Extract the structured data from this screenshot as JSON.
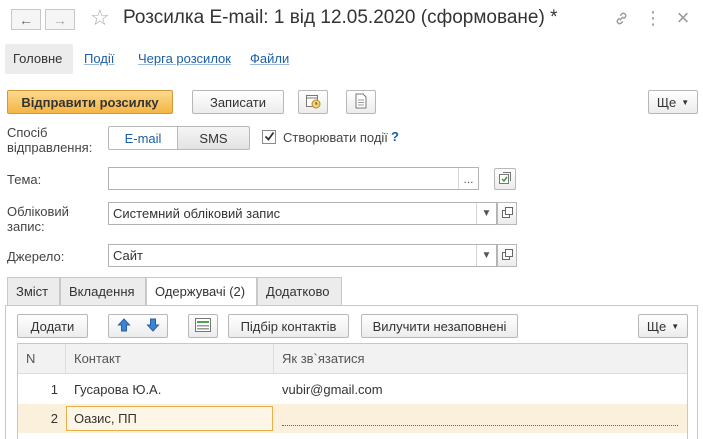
{
  "window": {
    "title": "Розсилка E-mail: 1 від 12.05.2020 (сформоване) *",
    "back_icon": "←",
    "forward_icon": "→",
    "star_icon": "☆",
    "link_icon": "🔗",
    "more_icon": "⋮",
    "close_icon": "×"
  },
  "top_tabs": [
    "Головне",
    "Події",
    "Черга розсилок",
    "Файли"
  ],
  "toolbar": {
    "send_label": "Відправити розсилку",
    "save_label": "Записати",
    "more_label": "Ще"
  },
  "form": {
    "send_method_label": "Спосіб відправлення:",
    "method_email": "E-mail",
    "method_sms": "SMS",
    "create_events_label": "Створювати події",
    "create_events_checked": true,
    "help_label": "?",
    "subject_label": "Тема:",
    "subject_value": "",
    "account_label": "Обліковий запис:",
    "account_value": "Системний обліковий запис",
    "source_label": "Джерело:",
    "source_value": "Сайт",
    "ellipsis": "..."
  },
  "inner_tabs": [
    "Зміст",
    "Вкладення",
    "Одержувачі (2)",
    "Додатково"
  ],
  "inner_toolbar": {
    "add_label": "Додати",
    "pick_contacts_label": "Підбір контактів",
    "remove_empty_label": "Вилучити незаповнені",
    "more_label": "Ще"
  },
  "table": {
    "columns": [
      "N",
      "Контакт",
      "Як зв`язатися"
    ],
    "rows": [
      {
        "n": "1",
        "contact": "Гусарова Ю.А.",
        "how": "vubir@gmail.com"
      },
      {
        "n": "2",
        "contact": "Оазис, ПП",
        "how": ""
      }
    ]
  },
  "colors": {
    "primary_button": "#f4b545",
    "link": "#1c5ea8",
    "selected_row": "#fbf0dc",
    "active_cell_border": "#e8b04d"
  }
}
